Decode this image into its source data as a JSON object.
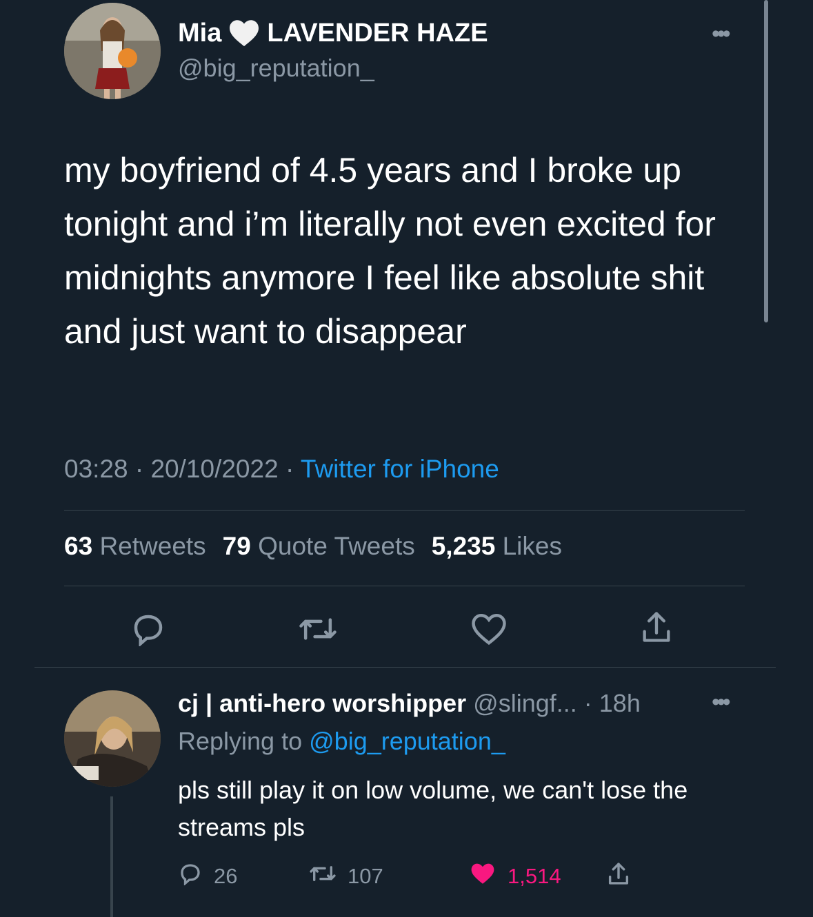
{
  "colors": {
    "background": "#15202b",
    "secondary_text": "#8b98a5",
    "link": "#1d9bf0",
    "like_pink": "#f91880",
    "divider": "#38444d"
  },
  "main_tweet": {
    "display_name_part1": "Mia",
    "name_emoji": "white-heart",
    "display_name_part2": "LAVENDER HAZE",
    "handle": "@big_reputation_",
    "more_icon": "more-horizontal-icon",
    "text": "my boyfriend of 4.5 years and I broke up tonight and i’m literally not even excited for midnights anymore I feel like absolute shit and just want to disappear",
    "time": "03:28",
    "separator": "·",
    "date": "20/10/2022",
    "source": "Twitter for iPhone",
    "stats": {
      "retweets_count": "63",
      "retweets_label": "Retweets",
      "quotes_count": "79",
      "quotes_label": "Quote Tweets",
      "likes_count": "5,235",
      "likes_label": "Likes"
    },
    "actions": [
      "reply-icon",
      "retweet-icon",
      "like-icon",
      "share-icon"
    ]
  },
  "reply": {
    "display_name": "cj | anti-hero worshipper",
    "handle": "@slingf...",
    "separator": "·",
    "time": "18h",
    "replying_prefix": "Replying to",
    "replying_mention": "@big_reputation_",
    "text": "pls still play it on low volume, we can't lose the streams pls",
    "replies": "26",
    "retweets": "107",
    "likes": "1,514",
    "liked": true
  }
}
